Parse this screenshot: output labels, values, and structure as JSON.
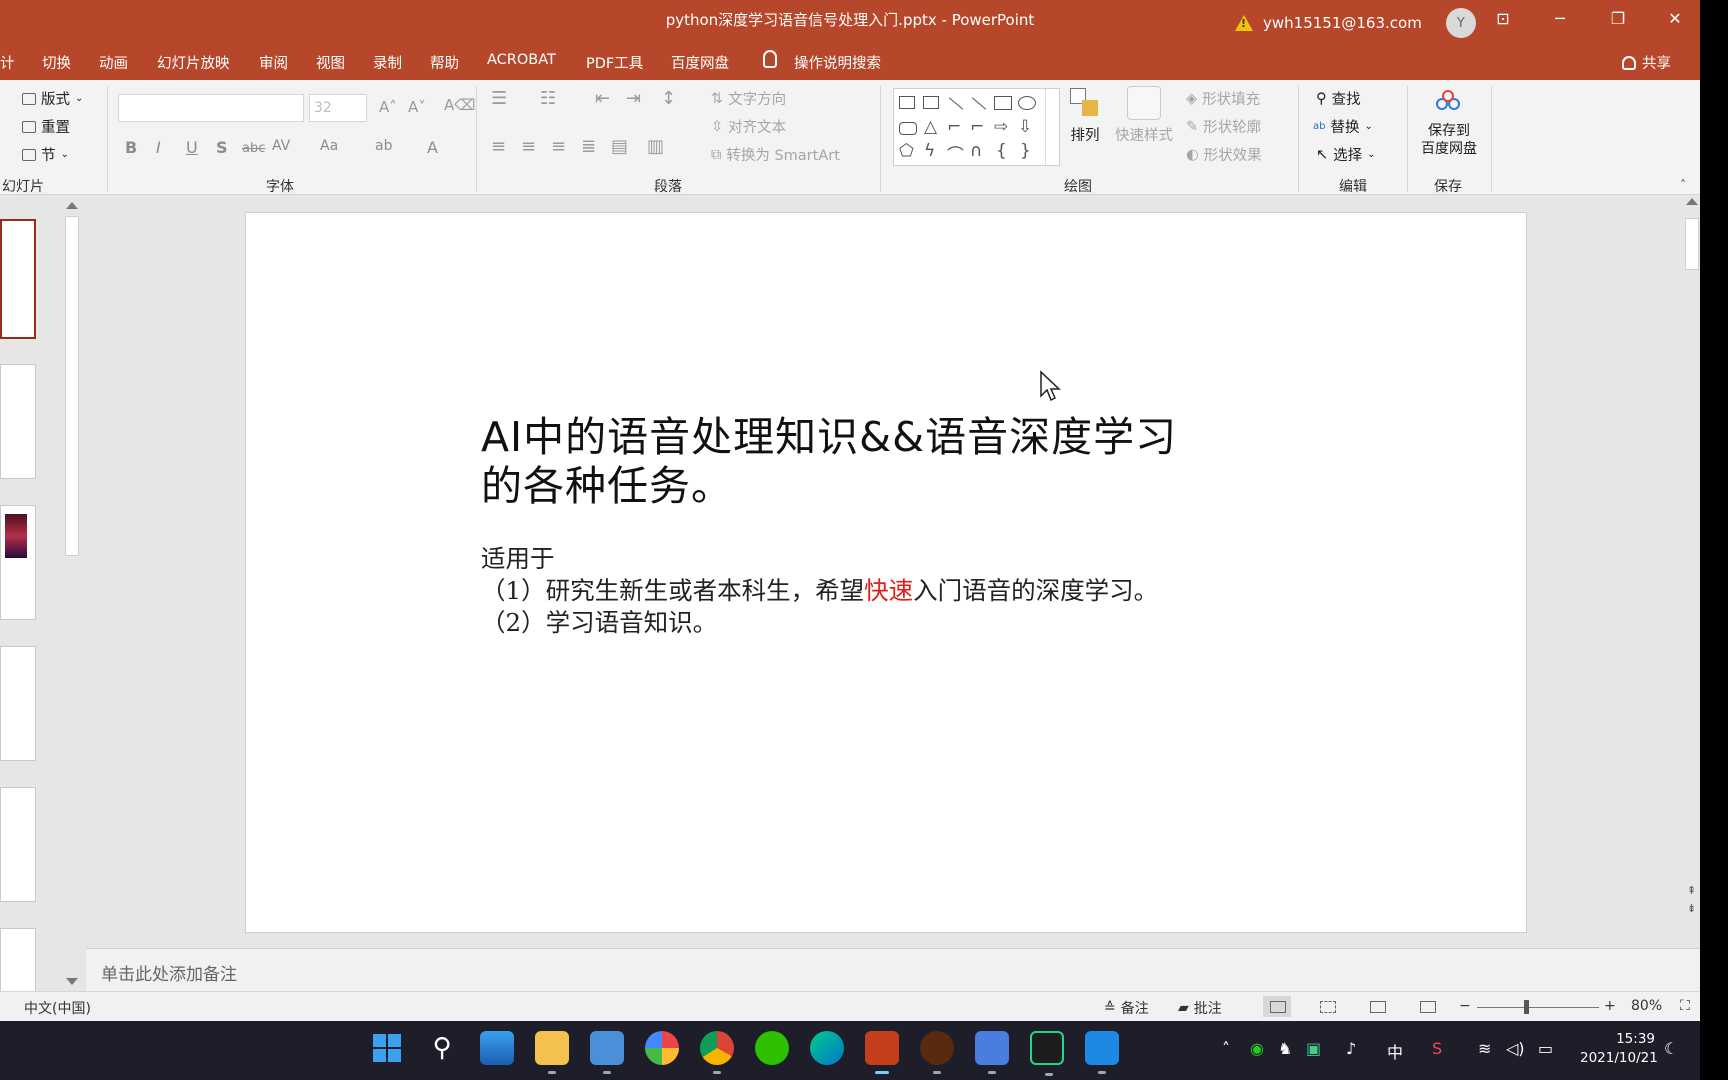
{
  "window": {
    "title": "python深度学习语音信号处理入门.pptx  -  PowerPoint",
    "account": "ywh15151@163.com",
    "avatar_initial": "Y",
    "accent": "#b7472a"
  },
  "menu": {
    "tabs": [
      "计",
      "切换",
      "动画",
      "幻灯片放映",
      "审阅",
      "视图",
      "录制",
      "帮助",
      "ACROBAT",
      "PDF工具",
      "百度网盘"
    ],
    "search": "操作说明搜索",
    "share": "共享"
  },
  "ribbon": {
    "slides_group": {
      "layout": "版式",
      "reset": "重置",
      "section": "节",
      "label": "幻灯片"
    },
    "font_group": {
      "size": "32",
      "label": "字体"
    },
    "paragraph_group": {
      "text_direction": "文字方向",
      "align_text": "对齐文本",
      "smartart": "转换为 SmartArt",
      "label": "段落"
    },
    "drawing_group": {
      "arrange": "排列",
      "quick_styles": "快速样式",
      "shape_fill": "形状填充",
      "shape_outline": "形状轮廓",
      "shape_effects": "形状效果",
      "label": "绘图"
    },
    "editing_group": {
      "find": "查找",
      "replace": "替换",
      "select": "选择",
      "label": "编辑"
    },
    "save_group": {
      "save_line1": "保存到",
      "save_line2": "百度网盘",
      "label": "保存"
    }
  },
  "slide": {
    "title": "AI中的语音处理知识&&语音深度学习的各种任务。",
    "body_line1": "适用于",
    "body_line2_pre": "（1）研究生新生或者本科生，希望",
    "body_line2_red": "快速",
    "body_line2_post": "入门语音的深度学习。",
    "body_line3": "（2）学习语音知识。"
  },
  "notes": {
    "placeholder": "单击此处添加备注"
  },
  "statusbar": {
    "language": "中文(中国)",
    "notes_btn": "备注",
    "comments_btn": "批注",
    "zoom_minus": "−",
    "zoom_plus": "+",
    "zoom": "80%"
  },
  "taskbar": {
    "time": "15:39",
    "date": "2021/10/21",
    "ime": "中"
  }
}
